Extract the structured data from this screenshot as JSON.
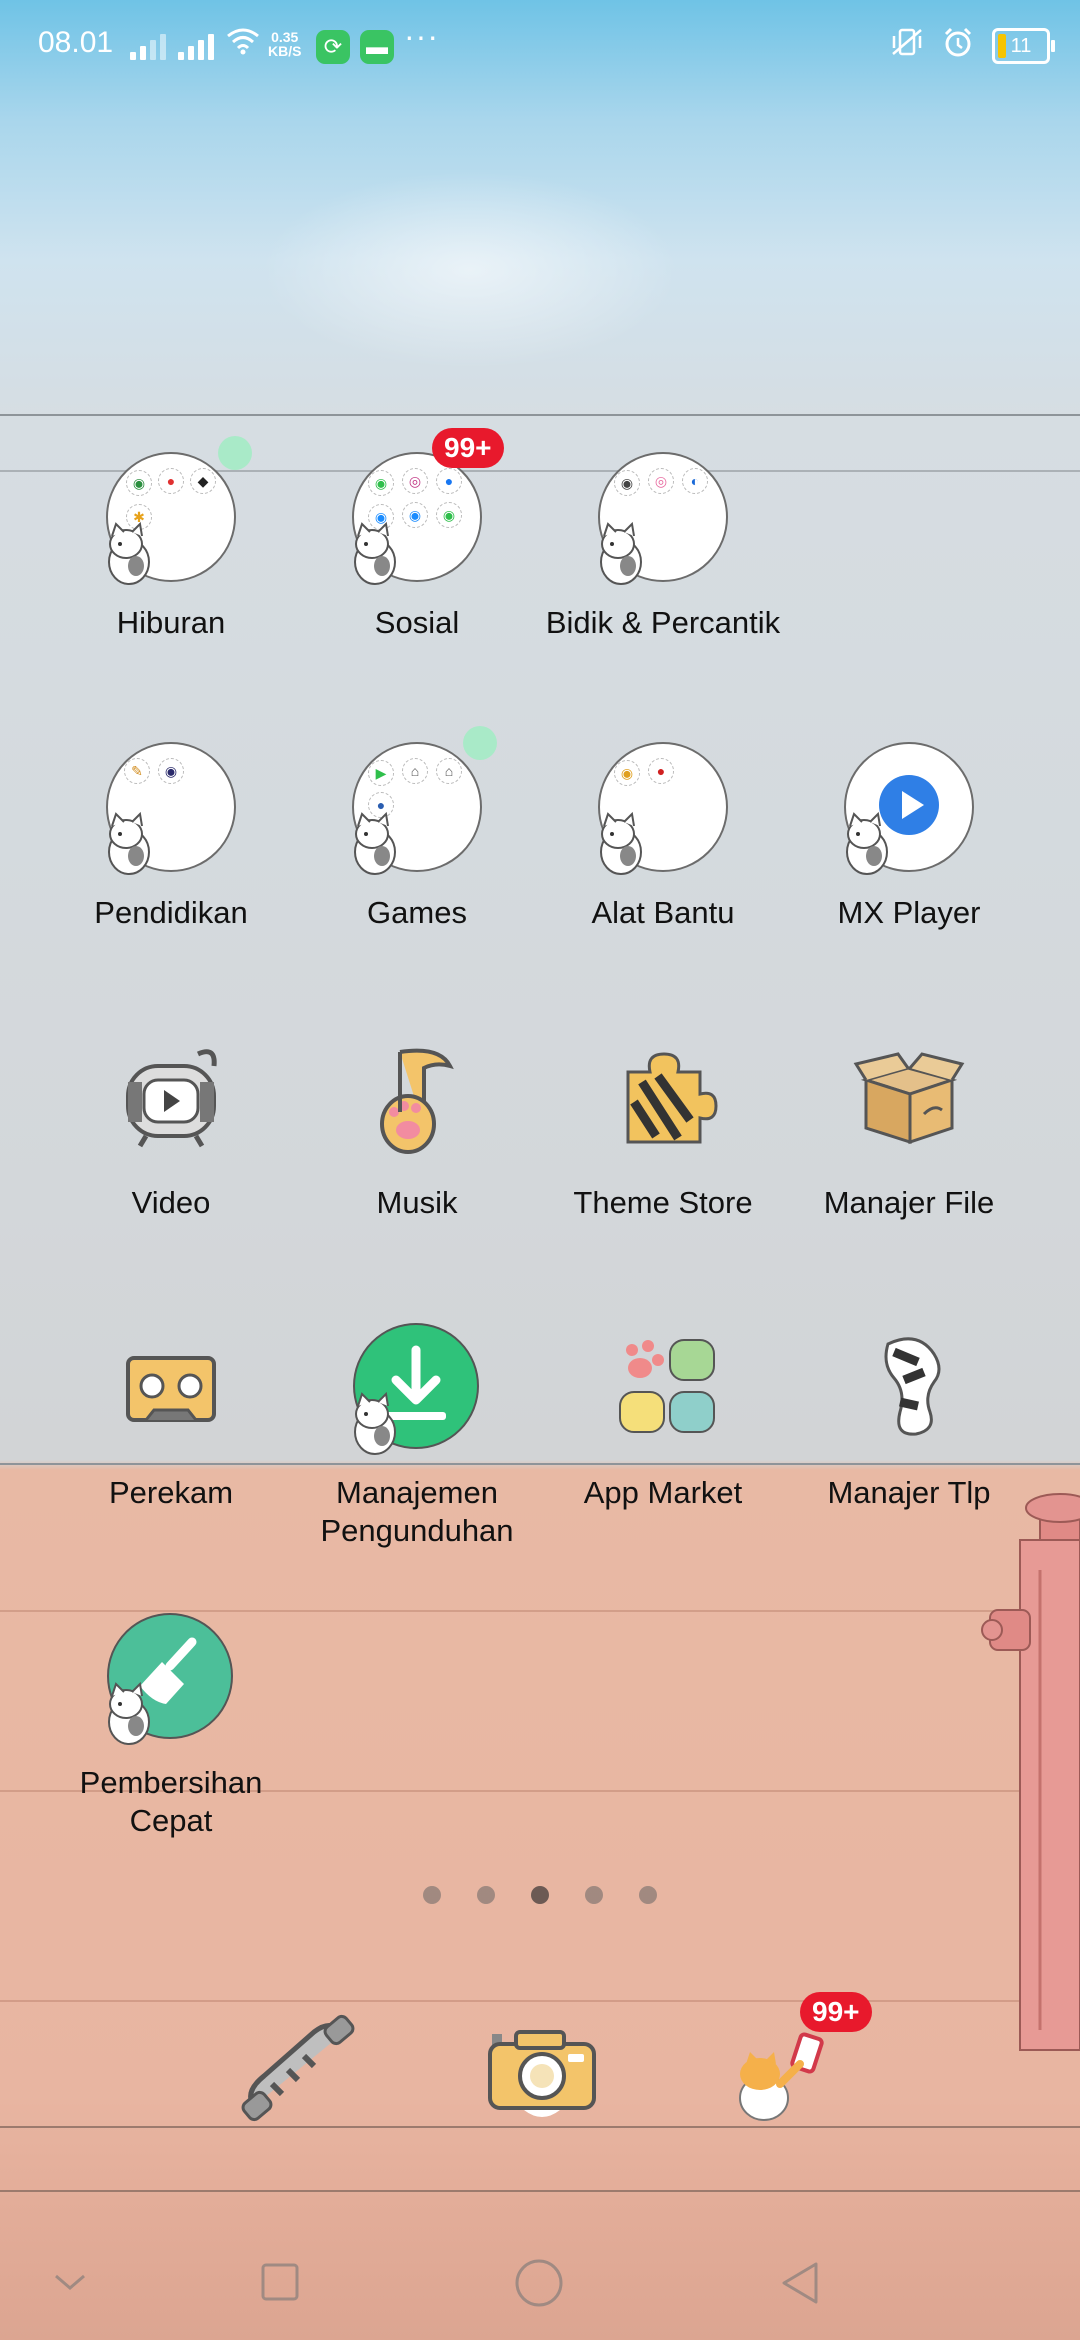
{
  "status_bar": {
    "time": "08.01",
    "net_speed_value": "0.35",
    "net_speed_unit": "KB/S",
    "more": "···",
    "battery_level": "11",
    "icons": [
      "signal-icon",
      "wifi-icon",
      "sync-app-icon",
      "message-app-icon",
      "vibrate-off-icon",
      "alarm-icon",
      "battery-icon"
    ]
  },
  "apps": {
    "hiburan": {
      "label": "Hiburan"
    },
    "sosial": {
      "label": "Sosial",
      "badge": "99+"
    },
    "bidik": {
      "label": "Bidik & Percantik"
    },
    "pendidikan": {
      "label": "Pendidikan"
    },
    "games": {
      "label": "Games"
    },
    "alat_bantu": {
      "label": "Alat Bantu"
    },
    "mx_player": {
      "label": "MX Player"
    },
    "video": {
      "label": "Video"
    },
    "musik": {
      "label": "Musik"
    },
    "theme_store": {
      "label": "Theme Store"
    },
    "manajer_file": {
      "label": "Manajer File"
    },
    "perekam": {
      "label": "Perekam"
    },
    "manajemen": {
      "label": "Manajemen Pengunduhan"
    },
    "app_market": {
      "label": "App Market"
    },
    "manajer_tlp": {
      "label": "Manajer Tlp"
    },
    "pembersihan": {
      "label": "Pembersihan Cepat"
    }
  },
  "pager": {
    "count": 5,
    "active_index": 2
  },
  "dock": {
    "messages_badge": "99+",
    "items": [
      "phone-icon",
      "camera-icon",
      "messages-icon"
    ]
  },
  "colors": {
    "badge": "#e8192c",
    "notification_dot": "#a9eac8",
    "mx_blue": "#2f7fe6",
    "green": "#2fc27a"
  }
}
